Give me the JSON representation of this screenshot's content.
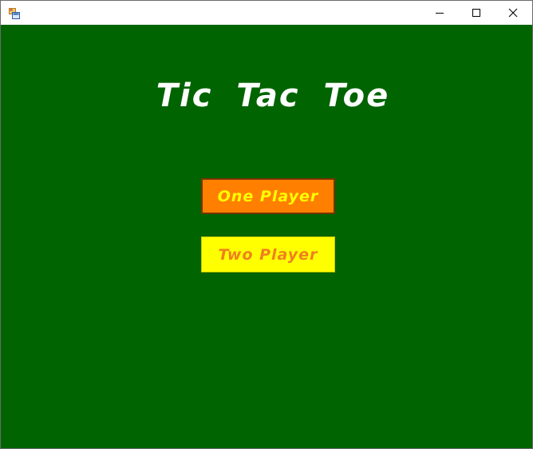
{
  "window": {
    "app_icon": "winforms-app-icon",
    "controls": {
      "minimize_icon": "minimize-icon",
      "maximize_icon": "maximize-icon",
      "close_icon": "close-icon"
    }
  },
  "main": {
    "title": "Tic Tac Toe",
    "one_player_label": "One Player",
    "two_player_label": "Two Player"
  },
  "colors": {
    "background": "#006400",
    "title_text": "#ffffff",
    "one_player_bg": "#ff8000",
    "one_player_text": "#ffff00",
    "two_player_bg": "#ffff00",
    "two_player_text": "#f08020"
  }
}
